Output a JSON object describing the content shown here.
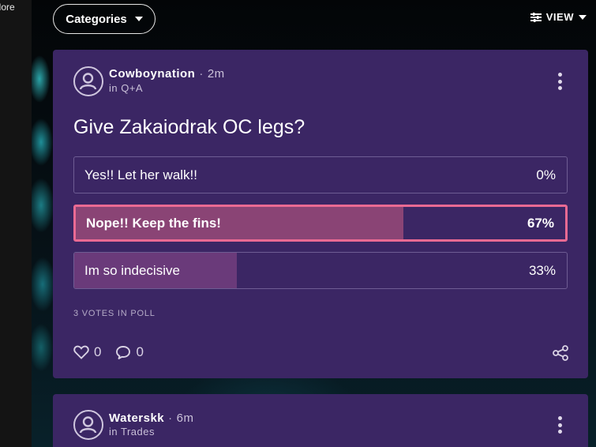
{
  "sidebar": {
    "label": "plore"
  },
  "topbar": {
    "categories_label": "Categories",
    "view_label": "VIEW"
  },
  "posts": [
    {
      "author": "Cowboynation",
      "time": "2m",
      "channel": "in Q+A",
      "question": "Give Zakaiodrak OC legs?",
      "options": [
        {
          "label": "Yes!! Let her walk!!",
          "percent": "0%",
          "fraction": 0.0,
          "selected": false
        },
        {
          "label": "Nope!! Keep the fins!",
          "percent": "67%",
          "fraction": 0.67,
          "selected": true
        },
        {
          "label": "Im so indecisive",
          "percent": "33%",
          "fraction": 0.33,
          "selected": false
        }
      ],
      "votes_text": "3 VOTES IN POLL",
      "likes": "0",
      "comments": "0"
    },
    {
      "author": "Waterskk",
      "time": "6m",
      "channel": "in Trades"
    }
  ],
  "colors": {
    "card_bg": "#3b2664",
    "selected_border": "#ea6a93",
    "fill": "#6a3a7a"
  }
}
